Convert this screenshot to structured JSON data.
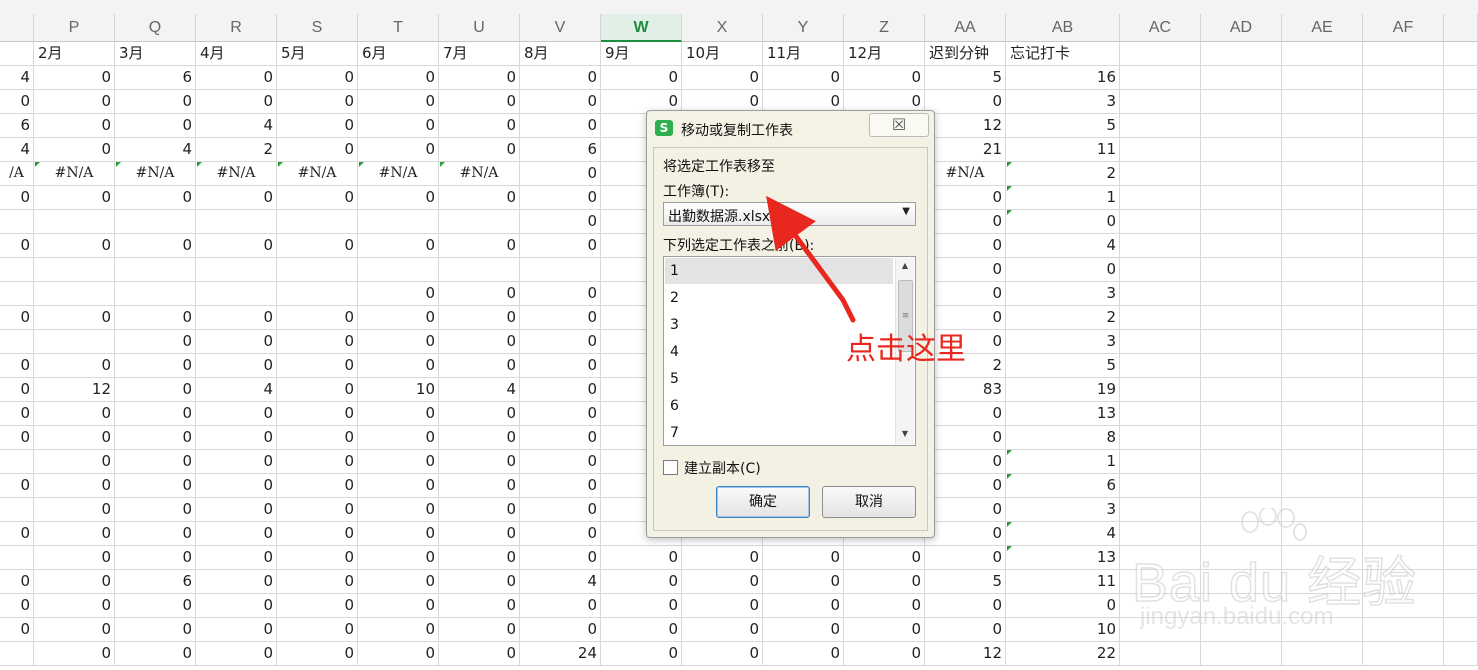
{
  "columns": [
    "",
    "P",
    "Q",
    "R",
    "S",
    "T",
    "U",
    "V",
    "W",
    "X",
    "Y",
    "Z",
    "AA",
    "AB",
    "AC",
    "AD",
    "AE",
    "AF",
    ""
  ],
  "selected_column": "W",
  "header_row": [
    "",
    "2月",
    "3月",
    "4月",
    "5月",
    "6月",
    "7月",
    "8月",
    "9月",
    "10月",
    "11月",
    "12月",
    "迟到分钟",
    "忘记打卡"
  ],
  "rows": [
    [
      "4",
      "0",
      "6",
      "0",
      "0",
      "0",
      "0",
      "0",
      "0",
      "0",
      "0",
      "0",
      "5",
      "16"
    ],
    [
      "0",
      "0",
      "0",
      "0",
      "0",
      "0",
      "0",
      "0",
      "0",
      "0",
      "0",
      "0",
      "0",
      "3"
    ],
    [
      "6",
      "0",
      "0",
      "4",
      "0",
      "0",
      "0",
      "0",
      "",
      "",
      "",
      "",
      "12",
      "5"
    ],
    [
      "4",
      "0",
      "4",
      "2",
      "0",
      "0",
      "0",
      "6",
      "",
      "",
      "",
      "",
      "21",
      "11"
    ],
    [
      "/A",
      "#N/A",
      "#N/A",
      "#N/A",
      "#N/A",
      "#N/A",
      "#N/A",
      "0",
      "",
      "",
      "",
      "",
      "#N/A",
      "2"
    ],
    [
      "0",
      "0",
      "0",
      "0",
      "0",
      "0",
      "0",
      "0",
      "",
      "",
      "",
      "",
      "0",
      "1"
    ],
    [
      "",
      "",
      "",
      "",
      "",
      "",
      "",
      "0",
      "",
      "",
      "",
      "",
      "0",
      "0"
    ],
    [
      "0",
      "0",
      "0",
      "0",
      "0",
      "0",
      "0",
      "0",
      "",
      "",
      "",
      "",
      "0",
      "4"
    ],
    [
      "",
      "",
      "",
      "",
      "",
      "",
      "",
      "",
      "",
      "",
      "",
      "",
      "0",
      "0"
    ],
    [
      "",
      "",
      "",
      "",
      "",
      "0",
      "0",
      "0",
      "",
      "",
      "",
      "",
      "0",
      "3"
    ],
    [
      "0",
      "0",
      "0",
      "0",
      "0",
      "0",
      "0",
      "0",
      "",
      "",
      "",
      "",
      "0",
      "2"
    ],
    [
      "",
      "",
      "0",
      "0",
      "0",
      "0",
      "0",
      "0",
      "",
      "",
      "",
      "",
      "0",
      "3"
    ],
    [
      "0",
      "0",
      "0",
      "0",
      "0",
      "0",
      "0",
      "0",
      "",
      "",
      "",
      "",
      "2",
      "5"
    ],
    [
      "0",
      "12",
      "0",
      "4",
      "0",
      "10",
      "4",
      "0",
      "",
      "",
      "",
      "",
      "83",
      "19"
    ],
    [
      "0",
      "0",
      "0",
      "0",
      "0",
      "0",
      "0",
      "0",
      "",
      "",
      "",
      "",
      "0",
      "13"
    ],
    [
      "0",
      "0",
      "0",
      "0",
      "0",
      "0",
      "0",
      "0",
      "",
      "",
      "",
      "",
      "0",
      "8"
    ],
    [
      "",
      "0",
      "0",
      "0",
      "0",
      "0",
      "0",
      "0",
      "",
      "",
      "",
      "",
      "0",
      "1"
    ],
    [
      "0",
      "0",
      "0",
      "0",
      "0",
      "0",
      "0",
      "0",
      "",
      "",
      "",
      "",
      "0",
      "6"
    ],
    [
      "",
      "0",
      "0",
      "0",
      "0",
      "0",
      "0",
      "0",
      "",
      "",
      "",
      "",
      "0",
      "3"
    ],
    [
      "0",
      "0",
      "0",
      "0",
      "0",
      "0",
      "0",
      "0",
      "",
      "",
      "",
      "",
      "0",
      "4"
    ],
    [
      "",
      "0",
      "0",
      "0",
      "0",
      "0",
      "0",
      "0",
      "0",
      "0",
      "0",
      "0",
      "0",
      "13"
    ],
    [
      "0",
      "0",
      "6",
      "0",
      "0",
      "0",
      "0",
      "4",
      "0",
      "0",
      "0",
      "0",
      "5",
      "11"
    ],
    [
      "0",
      "0",
      "0",
      "0",
      "0",
      "0",
      "0",
      "0",
      "0",
      "0",
      "0",
      "0",
      "0",
      "0"
    ],
    [
      "0",
      "0",
      "0",
      "0",
      "0",
      "0",
      "0",
      "0",
      "0",
      "0",
      "0",
      "0",
      "0",
      "10"
    ],
    [
      "",
      "0",
      "0",
      "0",
      "0",
      "0",
      "0",
      "24",
      "0",
      "0",
      "0",
      "0",
      "12",
      "22"
    ]
  ],
  "dialog": {
    "app_icon": "S",
    "title": "移动或复制工作表",
    "close_glyph": "☒",
    "move_label": "将选定工作表移至",
    "workbook_label": "工作簿(T):",
    "workbook_value": "出勤数据源.xlsx",
    "before_label": "下列选定工作表之前(B):",
    "sheets": [
      "1",
      "2",
      "3",
      "4",
      "5",
      "6",
      "7"
    ],
    "selected_sheet": "1",
    "copy_label": "建立副本(C)",
    "copy_checked": false,
    "ok_label": "确定",
    "cancel_label": "取消"
  },
  "annotation": {
    "text": "点击这里",
    "color": "#e8271f"
  },
  "watermark": {
    "logo": "Bai du 经验",
    "url": "jingyan.baidu.com"
  },
  "colors": {
    "accent_green": "#1e8e3e",
    "grid": "#d8d8d8",
    "header_bg": "#f3f3f3"
  }
}
